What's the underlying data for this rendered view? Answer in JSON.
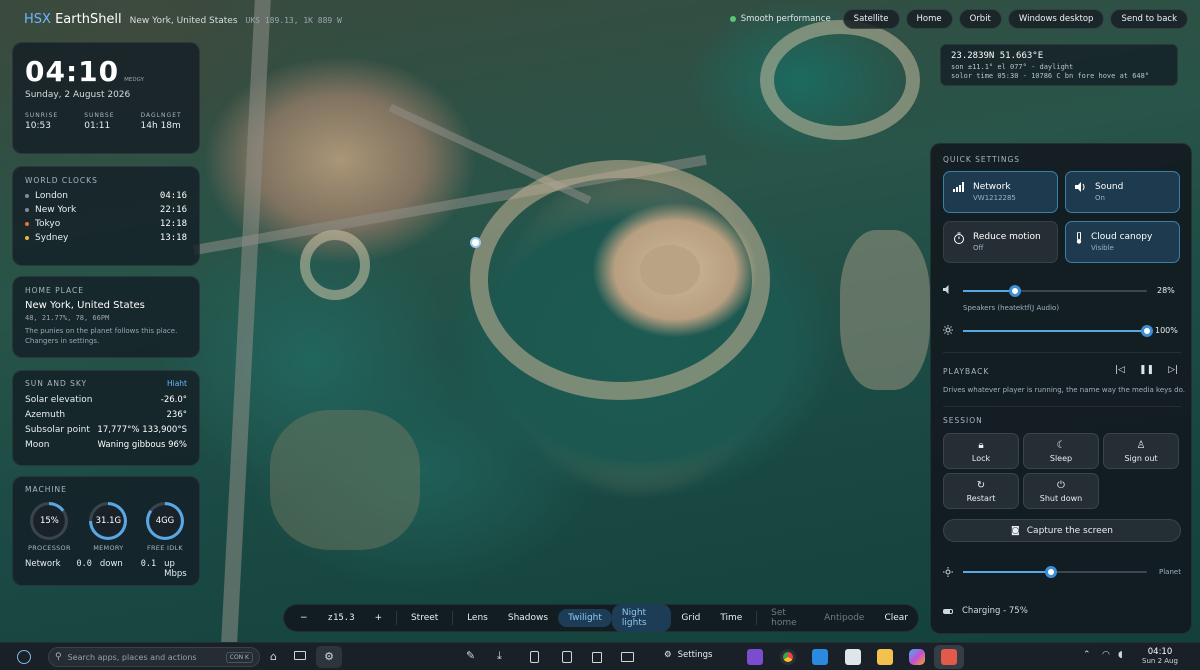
{
  "header": {
    "brand_prefix": "HSX",
    "brand_name": "EarthShell",
    "location": "New York, United States",
    "coords": "UKS 189.13, 1K 889 W"
  },
  "nav": {
    "perf": "Smooth performance",
    "buttons": [
      "Satellite",
      "Home",
      "Orbit",
      "Windows desktop",
      "Send to back"
    ]
  },
  "clock": {
    "time": "04:10",
    "suffix": "MEDGY",
    "date": "Sunday, 2 August 2026",
    "sunrise_label": "SUNRISE",
    "sunrise": "10:53",
    "sunset_label": "SUNBSE",
    "sunset": "01:11",
    "daylight_label": "DAGLNGET",
    "daylight": "14h 18m"
  },
  "world_clocks": {
    "title": "WORLD CLOCKS",
    "items": [
      {
        "city": "London",
        "time": "04:16",
        "color": "#7f8c95"
      },
      {
        "city": "New York",
        "time": "22:16",
        "color": "#7f8c95"
      },
      {
        "city": "Tokyo",
        "time": "12:18",
        "color": "#e8743b"
      },
      {
        "city": "Sydney",
        "time": "13:18",
        "color": "#e2b742"
      }
    ]
  },
  "home_place": {
    "title": "HOME PLACE",
    "name": "New York, United States",
    "coords": "48, 21.77%, 78, 66PM",
    "note": "The punies on the planet follows this place. Changers in settings."
  },
  "sun_sky": {
    "title": "SUN AND SKY",
    "tag": "Hiaht",
    "rows": [
      {
        "k": "Solar elevation",
        "v": "-26.0°"
      },
      {
        "k": "Azemuth",
        "v": "236°"
      },
      {
        "k": "Subsolar point",
        "v": "17,777°% 133,900°S"
      },
      {
        "k": "Moon",
        "v": "Waning gibbous 96%"
      }
    ]
  },
  "machine": {
    "title": "MACHINE",
    "gauges": [
      {
        "value": "15%",
        "label": "PROCESSOR",
        "level": 0.15
      },
      {
        "value": "31.1G",
        "label": "MEMORY",
        "level": 0.75
      },
      {
        "value": "4GG",
        "label": "FREE IDLK",
        "level": 0.85
      }
    ],
    "net_label": "Network",
    "down": "0.0",
    "down_unit": "down",
    "up": "0.1",
    "up_unit": "up Mbps"
  },
  "readout": {
    "line1": "23.2839N 51.663°E",
    "line2": "son ±11.1° el 077° - daylight",
    "line3": "solor time 05:30 - 10786 C bn fore hove at 648°"
  },
  "quick": {
    "title": "QUICK SETTINGS",
    "tiles": [
      {
        "name": "Network",
        "sub": "VW1212285"
      },
      {
        "name": "Sound",
        "sub": "On"
      },
      {
        "name": "Reduce motion",
        "sub": "Off"
      },
      {
        "name": "Cloud canopy",
        "sub": "Visible"
      }
    ],
    "volume": "28%",
    "volume_level": 0.28,
    "speaker": "Speakers (heatektf(J Audio)",
    "brightness": "100%",
    "brightness_level": 1.0
  },
  "playback": {
    "title": "PLAYBACK",
    "desc": "Drives whatever player is running, the name way the media keys do."
  },
  "session": {
    "title": "SESSION",
    "buttons": [
      "Lock",
      "Sleep",
      "Sign out",
      "Restart",
      "Shut down"
    ],
    "capture": "Capture the screen",
    "planet_label": "Planet",
    "planet_level": 0.48,
    "charging": "Charging - 75%"
  },
  "toolbar": {
    "minus": "−",
    "zoom": "z15.3",
    "plus": "+",
    "items": [
      "Street",
      "Lens",
      "Shadows",
      "Twilight",
      "Night lights",
      "Grid",
      "Time",
      "Set home",
      "Antipode",
      "Clear"
    ]
  },
  "taskbar": {
    "search": "Search apps, places and actions",
    "shortcut": "CON K",
    "settings": "Settings",
    "time": "04:10",
    "date": "Sun 2 Aug"
  },
  "colors": {
    "accent": "#3f8fd6",
    "active_tile": "#1e3a4f",
    "perf_dot": "#56c776"
  }
}
